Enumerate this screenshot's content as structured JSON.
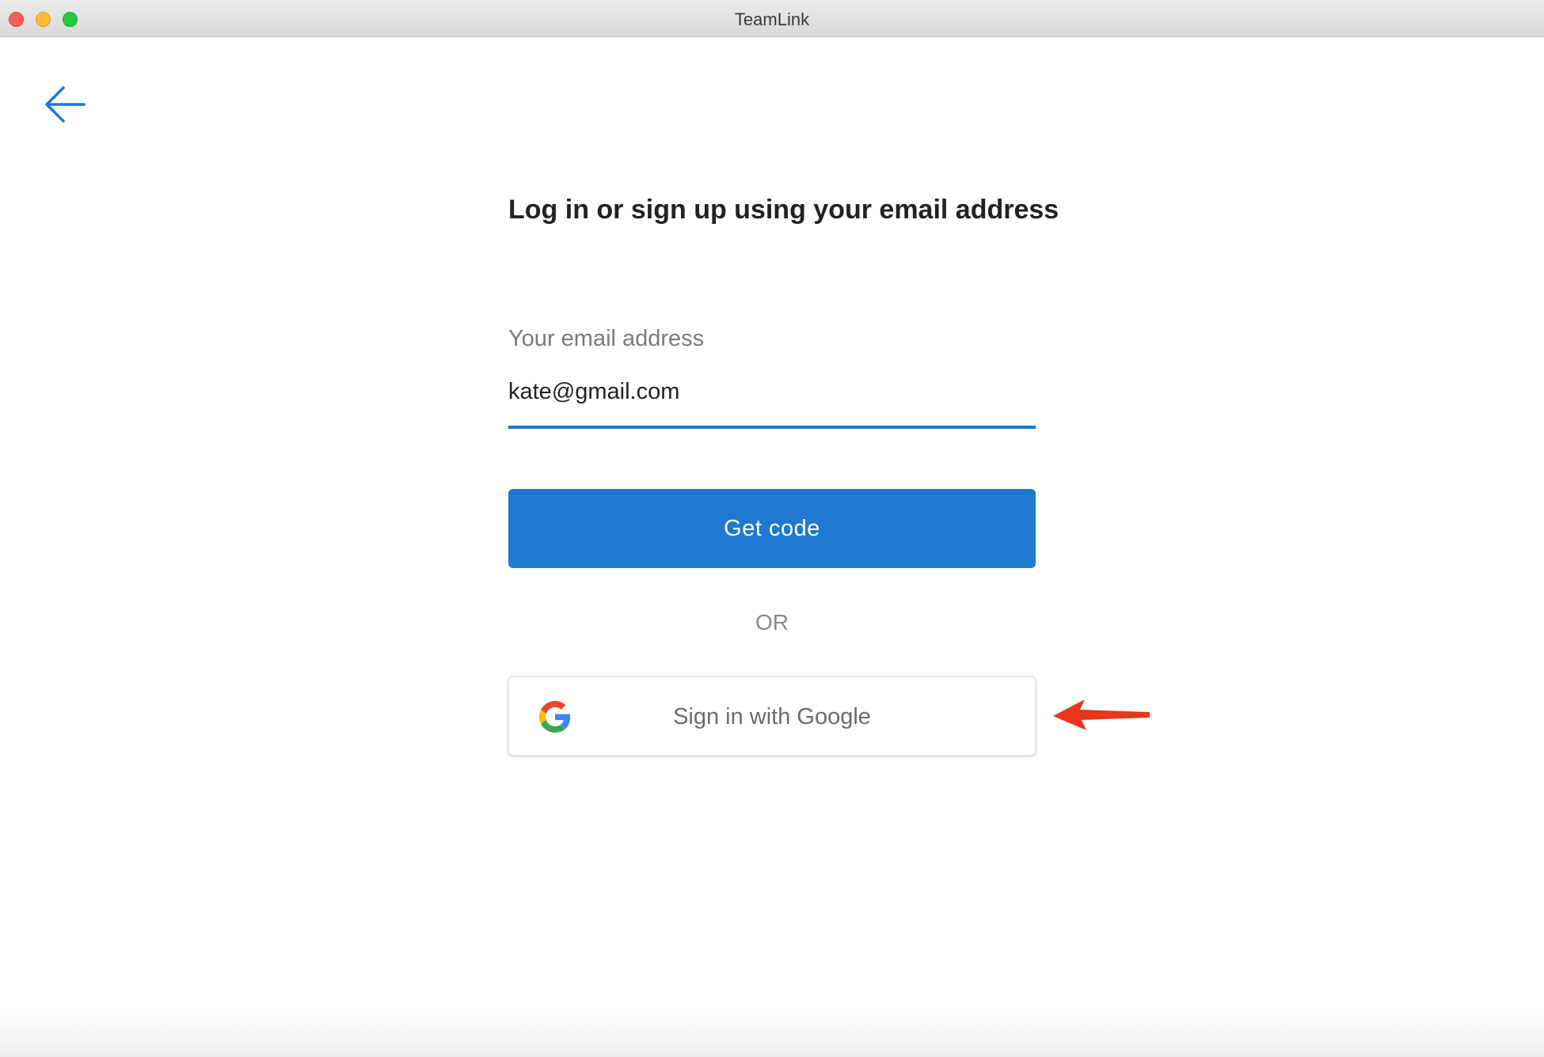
{
  "window": {
    "title": "TeamLink"
  },
  "icons": {
    "back": "back-arrow-icon",
    "google": "google-logo-icon",
    "annotation": "red-arrow-icon"
  },
  "colors": {
    "accent": "#1f78d1",
    "annotation": "#e8361c"
  },
  "login": {
    "heading": "Log in or sign up using your email address",
    "email_label": "Your email address",
    "email_value": "kate@gmail.com",
    "get_code_label": "Get code",
    "or_label": "OR",
    "google_label": "Sign in with Google"
  }
}
